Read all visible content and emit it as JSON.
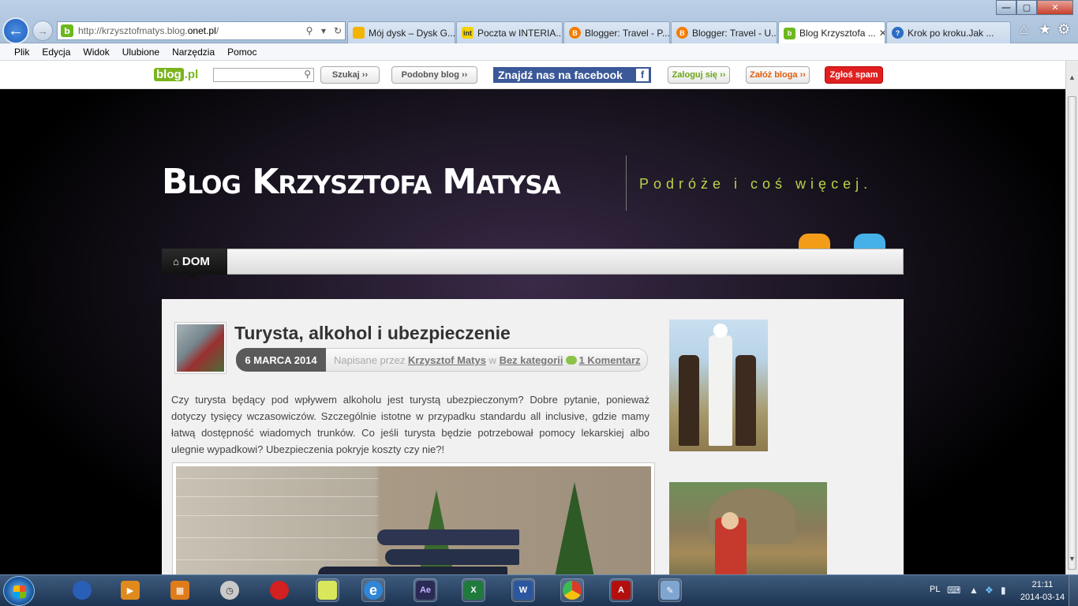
{
  "browser": {
    "address": {
      "url_prefix": "http://krzysztofmatys.blog.",
      "url_domain": "onet.pl",
      "url_suffix": "/",
      "search_icon": "search-icon",
      "refresh_icon": "refresh-icon"
    },
    "tabs": [
      {
        "label": "Mój dysk – Dysk G...",
        "icon": "drive-icon",
        "color": "#f4b400"
      },
      {
        "label": "Poczta w INTERIA....",
        "icon": "interia-icon",
        "color": "#f5d300"
      },
      {
        "label": "Blogger: Travel - P...",
        "icon": "blogger-icon",
        "color": "#f57d00"
      },
      {
        "label": "Blogger: Travel - U...",
        "icon": "blogger-icon",
        "color": "#f57d00"
      },
      {
        "label": "Blog Krzysztofa ...",
        "icon": "blog-pl-icon",
        "color": "#6cb81f",
        "active": true
      },
      {
        "label": "Krok po kroku.Jak ...",
        "icon": "help-icon",
        "color": "#2b6cc4"
      }
    ],
    "menu": [
      "Plik",
      "Edycja",
      "Widok",
      "Ulubione",
      "Narzędzia",
      "Pomoc"
    ]
  },
  "blogpl_bar": {
    "logo_left": "blog",
    "logo_right": ".pl",
    "search_placeholder": "",
    "search_button": "Szukaj ››",
    "similar_button": "Podobny blog ››",
    "facebook_text": "Znajdź nas na",
    "facebook_brand": "facebook",
    "login_button": "Zaloguj się ››",
    "create_button": "Załóż bloga ››",
    "spam_button": "Zgłoś spam",
    "accent": "#7ab51d"
  },
  "blog": {
    "title": "Blog Krzysztofa Matysa",
    "tagline": "Podróże i coś więcej.",
    "nav_home": "DOM",
    "post": {
      "title": "Turysta, alkohol i ubezpieczenie",
      "date": "6 MARCA 2014",
      "written_by": "Napisane przez",
      "author": "Krzysztof Matys",
      "in": "w",
      "category": "Bez kategorii",
      "comments": "1 Komentarz",
      "excerpt": "Czy turysta będący pod wpływem alkoholu jest turystą ubezpieczonym? Dobre pytanie, ponieważ dotyczy tysięcy wczasowiczów. Szczególnie istotne w przypadku standardu all inclusive, gdzie mamy łatwą dostępność wiadomych trunków.  Co jeśli turysta będzie potrzebował pomocy lekarskiej albo ulegnie wypadkowi? Ubezpieczenia pokryje koszty czy nie?!"
    }
  },
  "taskbar": {
    "lang": "PL",
    "time": "21:11",
    "date": "2014-03-14",
    "apps": [
      {
        "name": "user-app-icon",
        "color": "#2a5fb8",
        "label": ""
      },
      {
        "name": "media-player-icon",
        "color": "#e08a1e",
        "label": ""
      },
      {
        "name": "squares-app-icon",
        "color": "#e07b1a",
        "label": ""
      },
      {
        "name": "clock-app-icon",
        "color": "#c9c9c9",
        "label": ""
      },
      {
        "name": "pin-app-icon",
        "color": "#d32020",
        "label": ""
      },
      {
        "name": "sticky-notes-icon",
        "color": "#d9e85a",
        "label": ""
      },
      {
        "name": "internet-explorer-icon",
        "color": "#2f86d6",
        "label": "e"
      },
      {
        "name": "after-effects-icon",
        "color": "#2a2a55",
        "label": "Ae"
      },
      {
        "name": "excel-icon",
        "color": "#1f7a3c",
        "label": "X"
      },
      {
        "name": "word-icon",
        "color": "#2b57a0",
        "label": "W"
      },
      {
        "name": "chrome-icon",
        "color": "#db3b2b",
        "label": ""
      },
      {
        "name": "acrobat-icon",
        "color": "#b40f0f",
        "label": ""
      },
      {
        "name": "paint-icon",
        "color": "#7fa6d1",
        "label": ""
      }
    ]
  }
}
